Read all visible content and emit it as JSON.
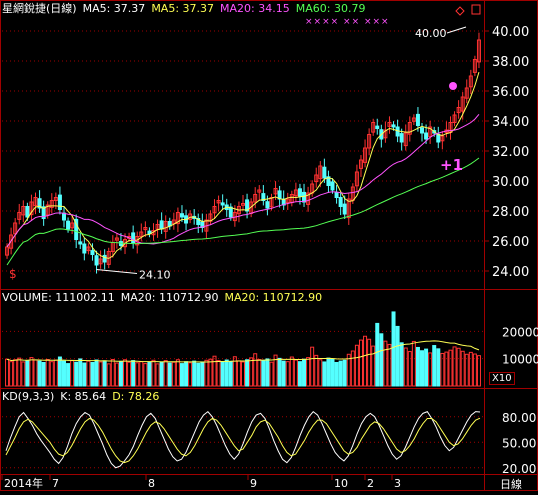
{
  "header": {
    "stock_title": "星網銳捷(日線)",
    "ma5_label": "MA5: 37.37",
    "ma5_label_2": "MA5: 37.37",
    "ma20_label": "MA20: 34.15",
    "ma60_label": "MA60: 30.79"
  },
  "volume_header": {
    "volume_label": "VOLUME: 111002.11",
    "ma20_label": "MA20: 110712.90",
    "ma20_label_2": "MA20: 110712.90"
  },
  "kd_header": {
    "kd_label": "KD(9,3,3)",
    "k_label": "K: 85.64",
    "d_label": "D: 78.26"
  },
  "volume_unit": "X10",
  "x_axis_corner": "日線",
  "annotations": {
    "high": "40.00",
    "low": "24.10",
    "plus": "+1",
    "dollar": "$",
    "x_marks": "××××  ××  ×××"
  },
  "colors": {
    "up": "#ff3232",
    "down": "#54ffff",
    "ma5": "#ffff54",
    "ma20": "#ff54ff",
    "ma60": "#54ff54",
    "grid": "#a00000",
    "axis_text": "#ffffff",
    "k_line": "#ffffff",
    "d_line": "#ffff54"
  },
  "chart_data": [
    {
      "type": "candlestick",
      "title": "星網銳捷(日線)",
      "y_ticks": [
        24.0,
        26.0,
        28.0,
        30.0,
        32.0,
        34.0,
        36.0,
        38.0,
        40.0
      ],
      "ylim": [
        23.0,
        41.0
      ],
      "x_tick_labels": [
        "2014年",
        "7",
        "8",
        "9",
        "10",
        "2",
        "3"
      ],
      "high_label": 40.0,
      "low_label": 24.1,
      "ma_values": {
        "MA5": 37.37,
        "MA20": 34.15,
        "MA60": 30.79
      },
      "close_prices": [
        25.6,
        26.4,
        27.2,
        27.9,
        28.3,
        27.6,
        28.6,
        28.9,
        28.2,
        27.5,
        28.4,
        28.7,
        28.9,
        28.1,
        27.4,
        26.8,
        27.2,
        26.1,
        25.8,
        25.2,
        25.6,
        25.1,
        24.4,
        24.8,
        24.6,
        25.3,
        25.9,
        26.2,
        25.7,
        26.1,
        26.3,
        25.9,
        26.3,
        26.6,
        26.9,
        26.5,
        26.7,
        27.1,
        26.8,
        27.3,
        27.0,
        27.4,
        27.9,
        27.6,
        27.2,
        27.8,
        27.5,
        27.1,
        26.9,
        27.4,
        27.8,
        28.3,
        28.7,
        28.4,
        28.1,
        27.6,
        27.9,
        28.3,
        28.5,
        28.0,
        28.6,
        29.1,
        29.4,
        28.7,
        28.2,
        28.9,
        29.5,
        28.8,
        28.4,
        28.8,
        29.1,
        29.4,
        29.0,
        28.6,
        29.2,
        29.8,
        30.4,
        31.0,
        30.2,
        29.7,
        29.4,
        28.9,
        28.3,
        27.8,
        28.8,
        29.6,
        30.6,
        31.4,
        32.2,
        33.1,
        33.9,
        33.5,
        32.8,
        33.4,
        33.9,
        33.6,
        33.0,
        32.6,
        33.2,
        33.9,
        34.2,
        33.7,
        33.2,
        32.8,
        33.6,
        33.2,
        32.6,
        33.0,
        33.4,
        33.9,
        34.4,
        34.9,
        35.6,
        36.2,
        37.0,
        38.1,
        39.4
      ],
      "volume_y_ticks": [
        10000,
        20000
      ],
      "volume_unit": "X10",
      "volume_ylim": [
        0,
        30000
      ],
      "volume": [
        9800,
        8900,
        9600,
        10200,
        8800,
        9300,
        10400,
        9500,
        9100,
        8600,
        9700,
        8900,
        9500,
        10600,
        9100,
        8200,
        9300,
        8700,
        9900,
        8400,
        9100,
        8600,
        9500,
        8800,
        9200,
        8100,
        9700,
        8400,
        9000,
        9600,
        8700,
        9300,
        8500,
        8900,
        8200,
        8600,
        9400,
        8100,
        8800,
        9300,
        8400,
        8700,
        9600,
        8200,
        8900,
        8500,
        9100,
        8300,
        8800,
        9400,
        9800,
        10900,
        9300,
        8700,
        9500,
        9000,
        10700,
        9200,
        8800,
        9600,
        10300,
        11800,
        9700,
        9200,
        9900,
        8700,
        11300,
        10100,
        9100,
        8900,
        10600,
        9500,
        8900,
        9800,
        10400,
        14200,
        11200,
        9600,
        8800,
        10200,
        9700,
        8600,
        9100,
        9400,
        11600,
        12800,
        14900,
        16800,
        18200,
        17100,
        14600,
        22900,
        19100,
        16400,
        15200,
        27100,
        21800,
        15800,
        13900,
        12600,
        16300,
        14100,
        12900,
        13500,
        12100,
        14800,
        13600,
        11900,
        12400,
        13100,
        14300,
        13800,
        12700,
        11600,
        12300,
        11700,
        11100
      ],
      "volume_ma20": 110712.9,
      "volume_current": 111002.11
    },
    {
      "type": "line",
      "title": "KD(9,3,3)",
      "y_ticks": [
        20.0,
        50.0,
        80.0
      ],
      "ylim": [
        15,
        95
      ],
      "series": [
        {
          "name": "K",
          "values": [
            40,
            55,
            68,
            80,
            85,
            78,
            70,
            60,
            52,
            45,
            38,
            30,
            25,
            32,
            45,
            60,
            72,
            80,
            85,
            82,
            72,
            60,
            48,
            35,
            25,
            20,
            22,
            28,
            35,
            45,
            58,
            70,
            80,
            84,
            78,
            66,
            54,
            42,
            33,
            28,
            30,
            38,
            50,
            62,
            74,
            82,
            86,
            80,
            70,
            58,
            46,
            36,
            30,
            36,
            48,
            62,
            74,
            82,
            84,
            78,
            66,
            52,
            40,
            30,
            26,
            32,
            44,
            58,
            70,
            80,
            86,
            82,
            72,
            60,
            48,
            38,
            32,
            28,
            34,
            46,
            60,
            72,
            80,
            84,
            80,
            70,
            58,
            46,
            36,
            30,
            34,
            44,
            56,
            68,
            78,
            84,
            86,
            78,
            68,
            56,
            46,
            40,
            44,
            54,
            64,
            74,
            82,
            86,
            85.64
          ]
        },
        {
          "name": "D",
          "values": [
            35,
            45,
            55,
            66,
            74,
            77,
            74,
            68,
            62,
            56,
            50,
            42,
            36,
            34,
            38,
            46,
            56,
            66,
            74,
            78,
            76,
            70,
            62,
            52,
            42,
            34,
            28,
            26,
            28,
            34,
            42,
            52,
            62,
            70,
            74,
            72,
            66,
            58,
            50,
            42,
            36,
            34,
            38,
            46,
            56,
            66,
            74,
            78,
            76,
            70,
            62,
            54,
            46,
            40,
            42,
            50,
            58,
            68,
            74,
            76,
            72,
            64,
            56,
            46,
            38,
            34,
            36,
            44,
            52,
            62,
            70,
            76,
            76,
            72,
            64,
            56,
            48,
            40,
            36,
            38,
            44,
            54,
            62,
            70,
            74,
            72,
            66,
            58,
            50,
            42,
            38,
            40,
            46,
            54,
            64,
            72,
            78,
            78,
            74,
            66,
            58,
            50,
            46,
            48,
            54,
            62,
            70,
            76,
            78.26
          ]
        }
      ]
    }
  ]
}
